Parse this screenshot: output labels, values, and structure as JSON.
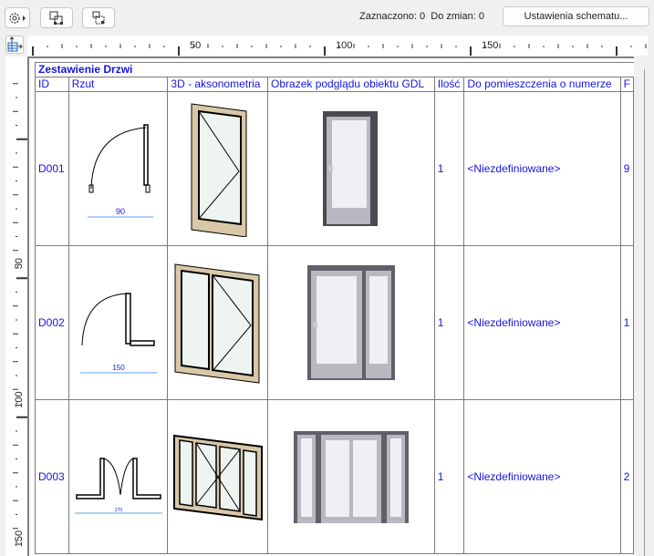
{
  "toolbar": {
    "icons": [
      "gear-menu-icon",
      "select-frame-icon",
      "group-select-icon"
    ],
    "status": "Zaznaczono: 0  Do zmian: 0",
    "settings_label": "Ustawienia schematu..."
  },
  "ruler": {
    "top_labels": [
      "50",
      "100",
      "150"
    ],
    "left_labels": [
      "50",
      "100",
      "150"
    ]
  },
  "schedule": {
    "title": "Zestawienie Drzwi",
    "headers": [
      "ID",
      "Rzut",
      "3D - aksonometria",
      "Obrazek podglądu obiektu GDL",
      "Ilość",
      "Do pomieszczenia o numerze",
      "F"
    ],
    "rows": [
      {
        "id": "D001",
        "plan_dim": "90",
        "qty": "1",
        "room": "<Niezdefiniowane>",
        "extra": "9"
      },
      {
        "id": "D002",
        "plan_dim": "150",
        "qty": "1",
        "room": "<Niezdefiniowane>",
        "extra": "1"
      },
      {
        "id": "D003",
        "plan_dim": "270",
        "qty": "1",
        "room": "<Niezdefiniowane>",
        "extra": "2"
      }
    ]
  },
  "colors": {
    "text": "#1515e0",
    "frame": "#d8c8a8",
    "dimension": "#5aa0f0"
  }
}
